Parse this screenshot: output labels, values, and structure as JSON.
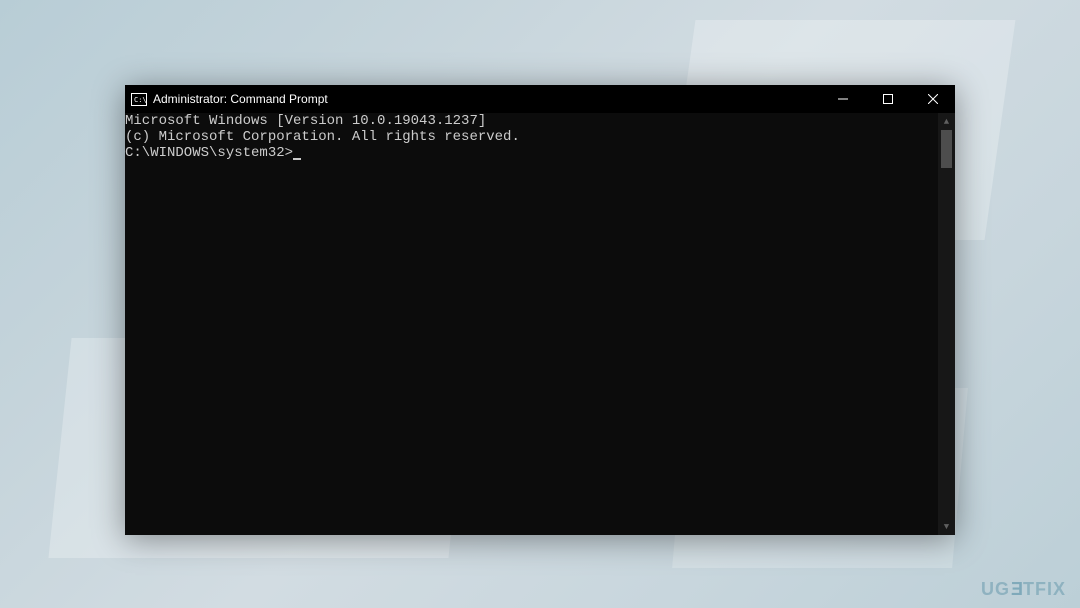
{
  "window": {
    "title": "Administrator: Command Prompt"
  },
  "terminal": {
    "line1": "Microsoft Windows [Version 10.0.19043.1237]",
    "line2": "(c) Microsoft Corporation. All rights reserved.",
    "blank": "",
    "prompt": "C:\\WINDOWS\\system32>"
  },
  "watermark": {
    "prefix": "UG",
    "special": "E",
    "suffix": "TFIX"
  }
}
